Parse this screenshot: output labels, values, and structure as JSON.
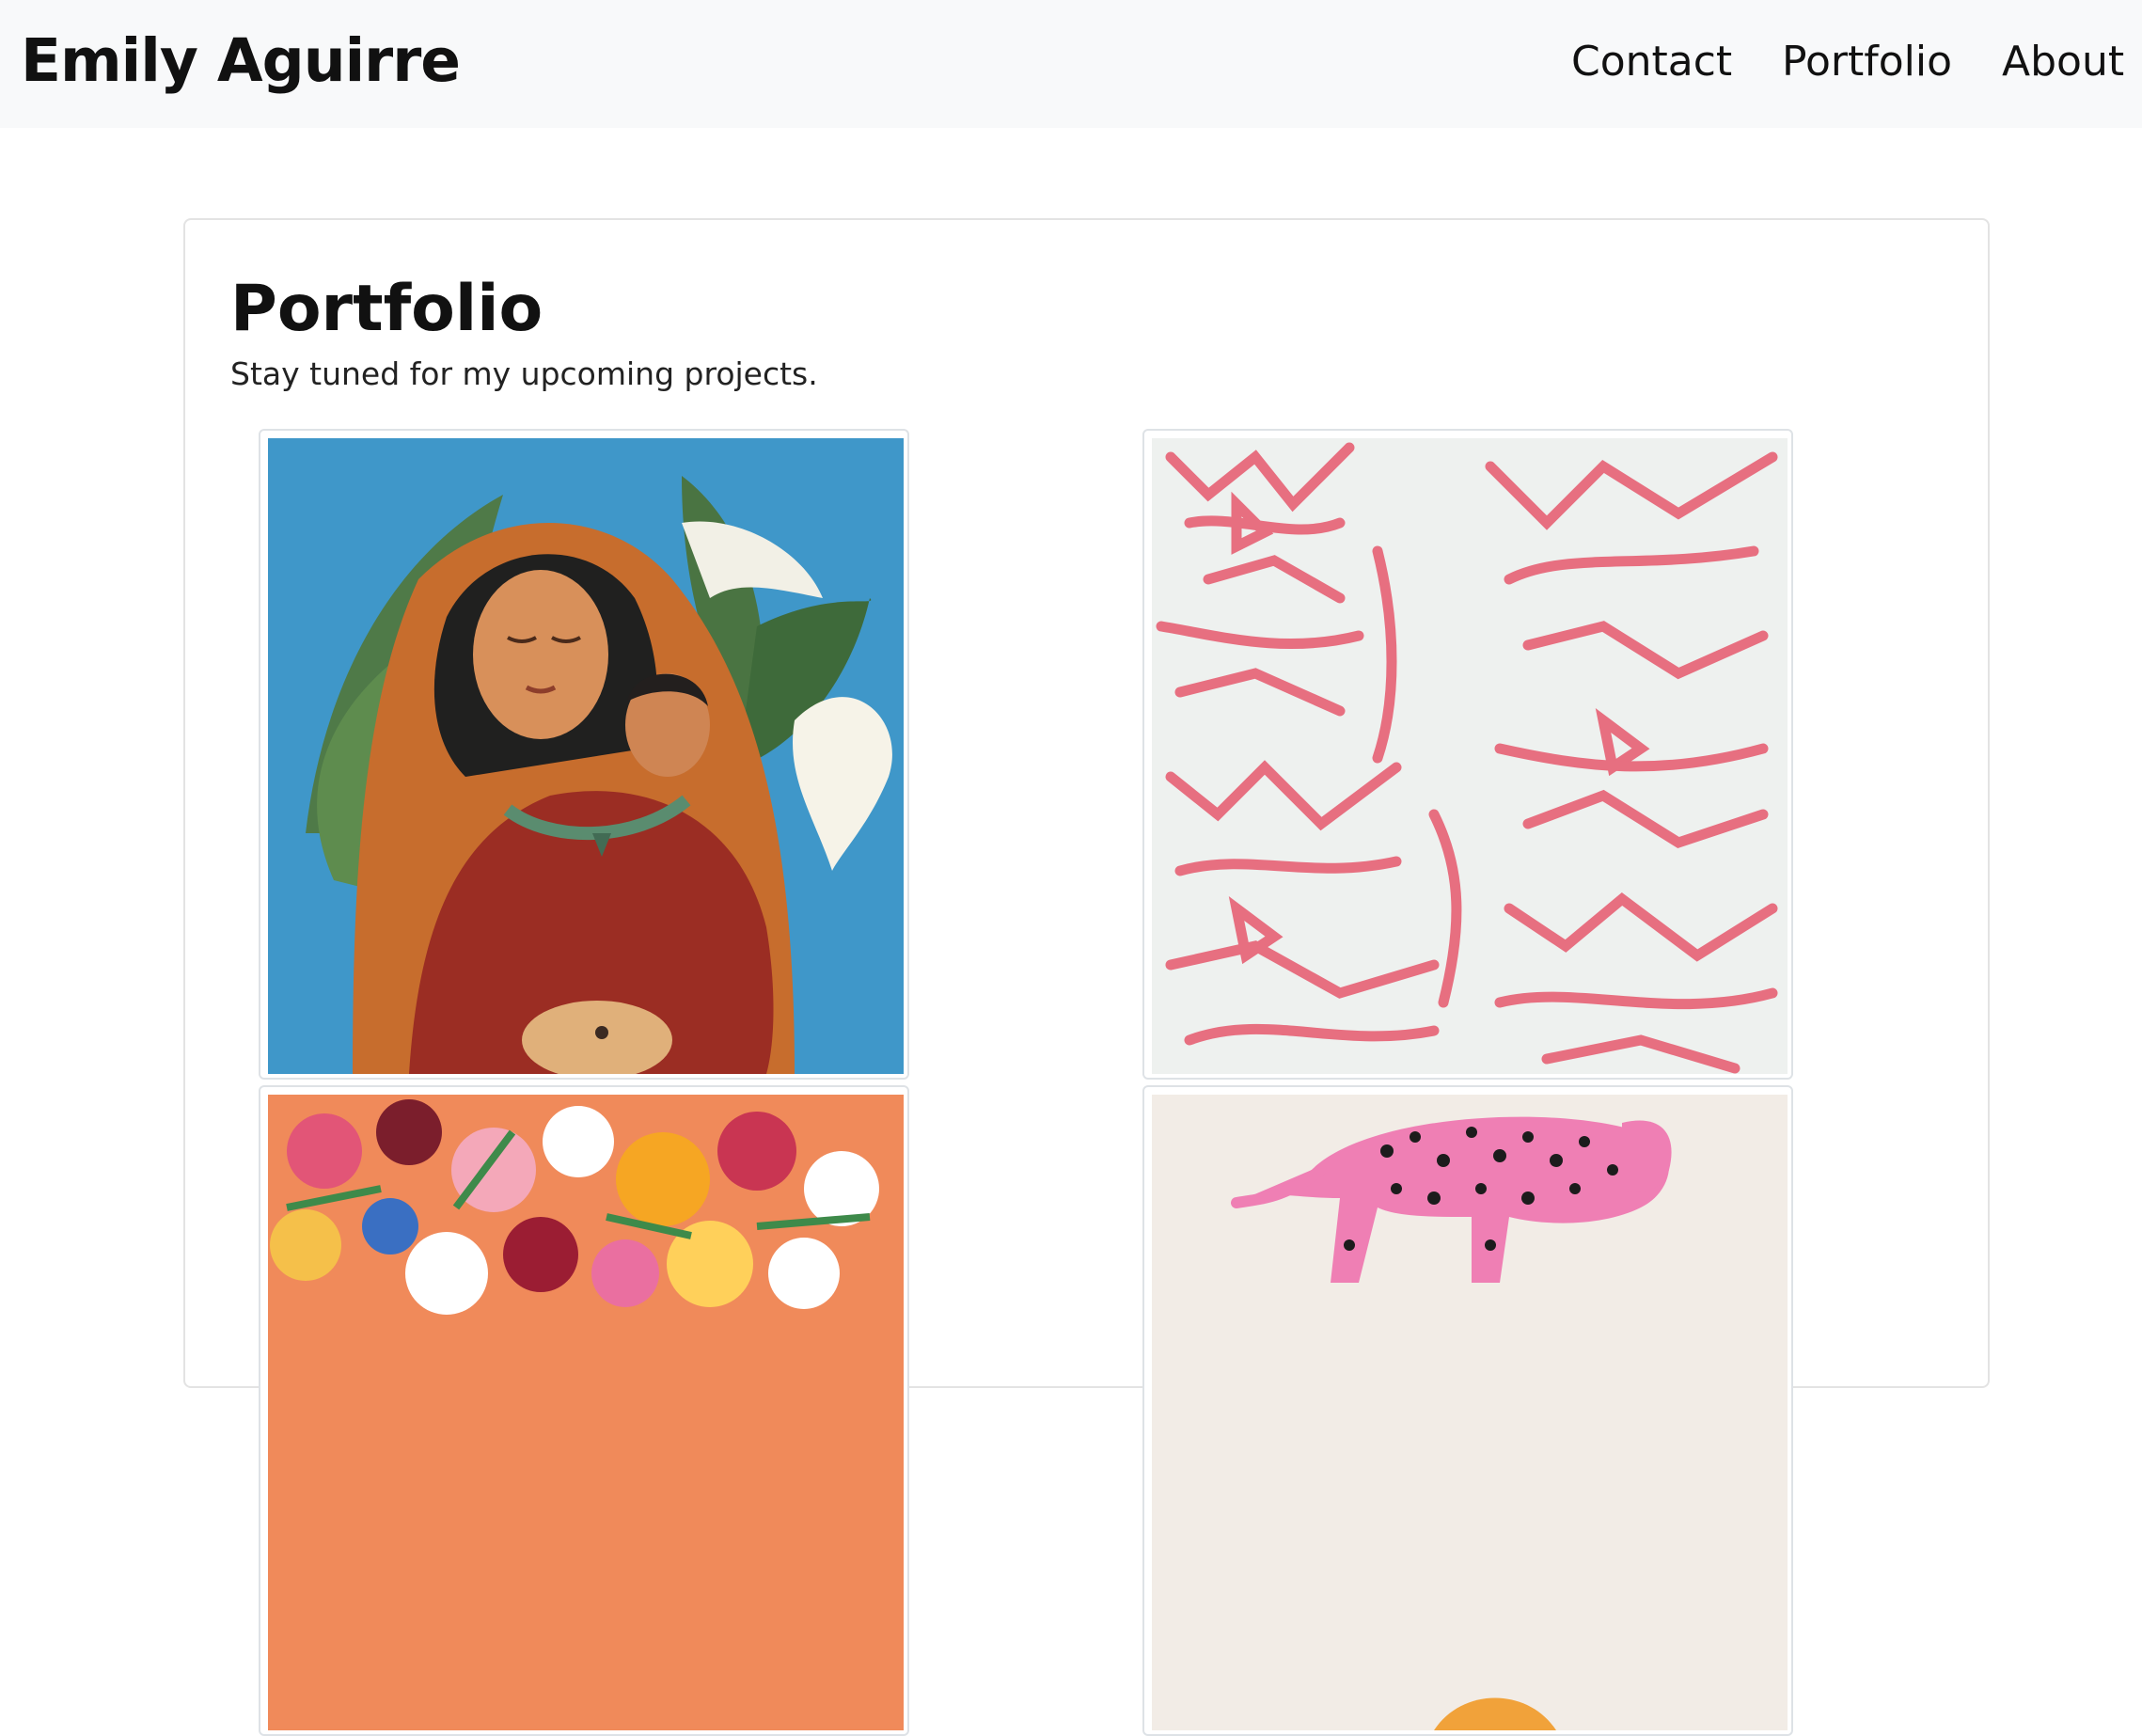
{
  "navbar": {
    "brand": "Emily Aguirre",
    "links": [
      {
        "label": "Contact"
      },
      {
        "label": "Portfolio"
      },
      {
        "label": "About"
      }
    ],
    "background": "#f8f9fa"
  },
  "main": {
    "title": "Portfolio",
    "subtitle": "Stay tuned for my upcoming projects.",
    "gallery": [
      {
        "name": "mother-and-child-painting"
      },
      {
        "name": "pink-tiger-pattern"
      },
      {
        "name": "flower-bouquet-painting"
      },
      {
        "name": "pink-leopard-illustration"
      }
    ]
  }
}
